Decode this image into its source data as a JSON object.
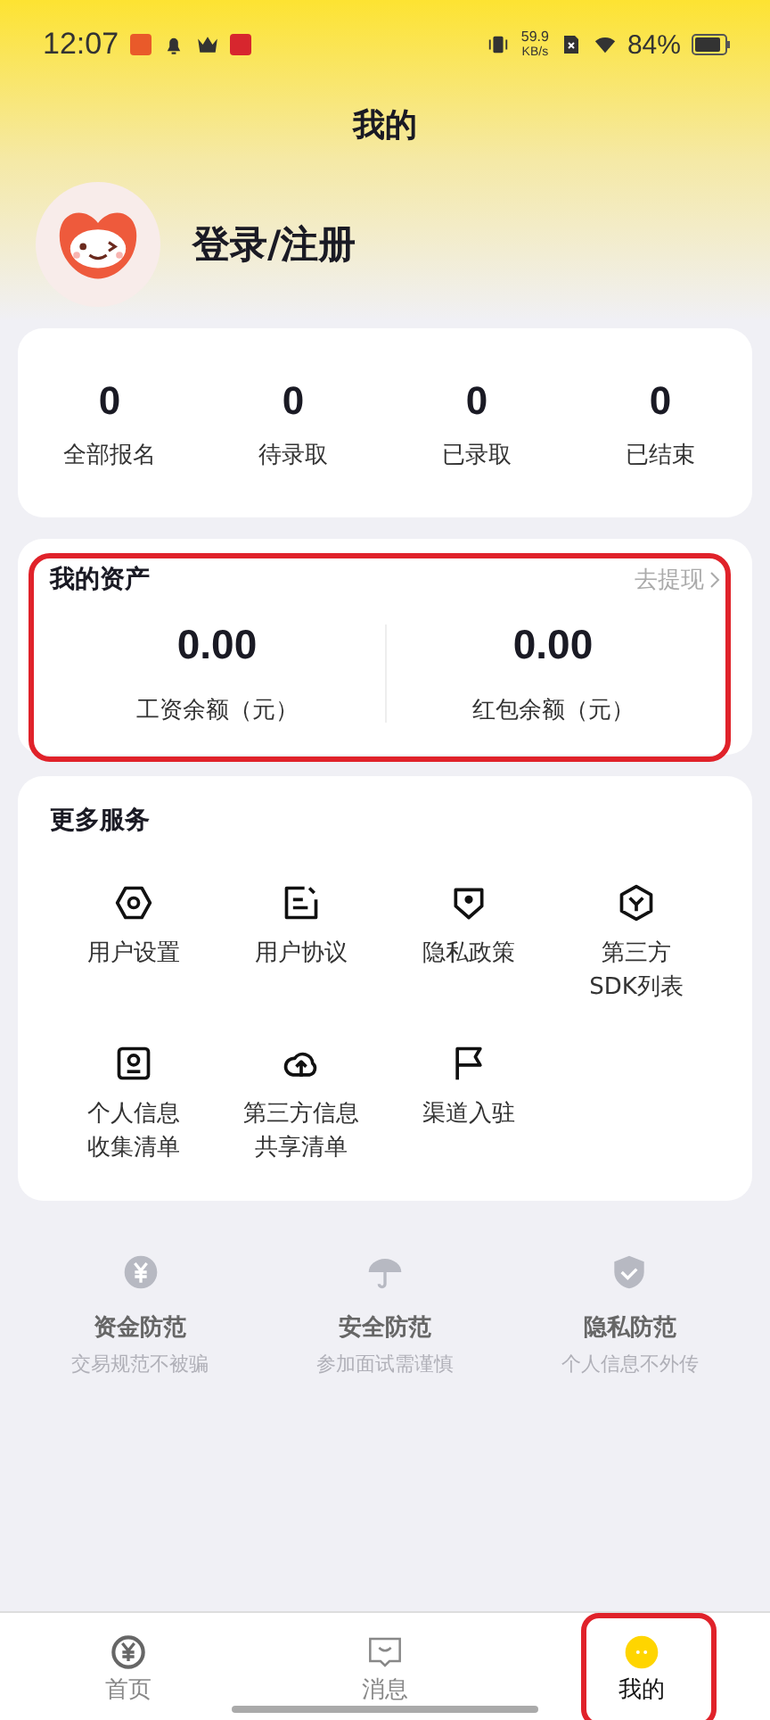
{
  "status_bar": {
    "time": "12:07",
    "net_speed": "59.9",
    "net_unit": "KB/s",
    "battery": "84%"
  },
  "header": {
    "title": "我的"
  },
  "profile": {
    "login": "登录/注册"
  },
  "stats": [
    {
      "value": "0",
      "label": "全部报名"
    },
    {
      "value": "0",
      "label": "待录取"
    },
    {
      "value": "0",
      "label": "已录取"
    },
    {
      "value": "0",
      "label": "已结束"
    }
  ],
  "assets": {
    "title": "我的资产",
    "link": "去提现",
    "highlighted": true,
    "items": [
      {
        "value": "0.00",
        "label": "工资余额（元）"
      },
      {
        "value": "0.00",
        "label": "红包余额（元）"
      }
    ]
  },
  "services": {
    "title": "更多服务",
    "items": [
      {
        "label": "用户设置"
      },
      {
        "label": "用户协议"
      },
      {
        "label": "隐私政策"
      },
      {
        "label": "第三方\nSDK列表"
      },
      {
        "label": "个人信息收集清单"
      },
      {
        "label": "第三方信息共享清单"
      },
      {
        "label": "渠道入驻"
      }
    ]
  },
  "safety": [
    {
      "title": "资金防范",
      "subtitle": "交易规范不被骗"
    },
    {
      "title": "安全防范",
      "subtitle": "参加面试需谨慎"
    },
    {
      "title": "隐私防范",
      "subtitle": "个人信息不外传"
    }
  ],
  "tab_bar": [
    {
      "label": "首页",
      "selected": false,
      "highlighted": false
    },
    {
      "label": "消息",
      "selected": false,
      "highlighted": false
    },
    {
      "label": "我的",
      "selected": true,
      "highlighted": true
    }
  ]
}
